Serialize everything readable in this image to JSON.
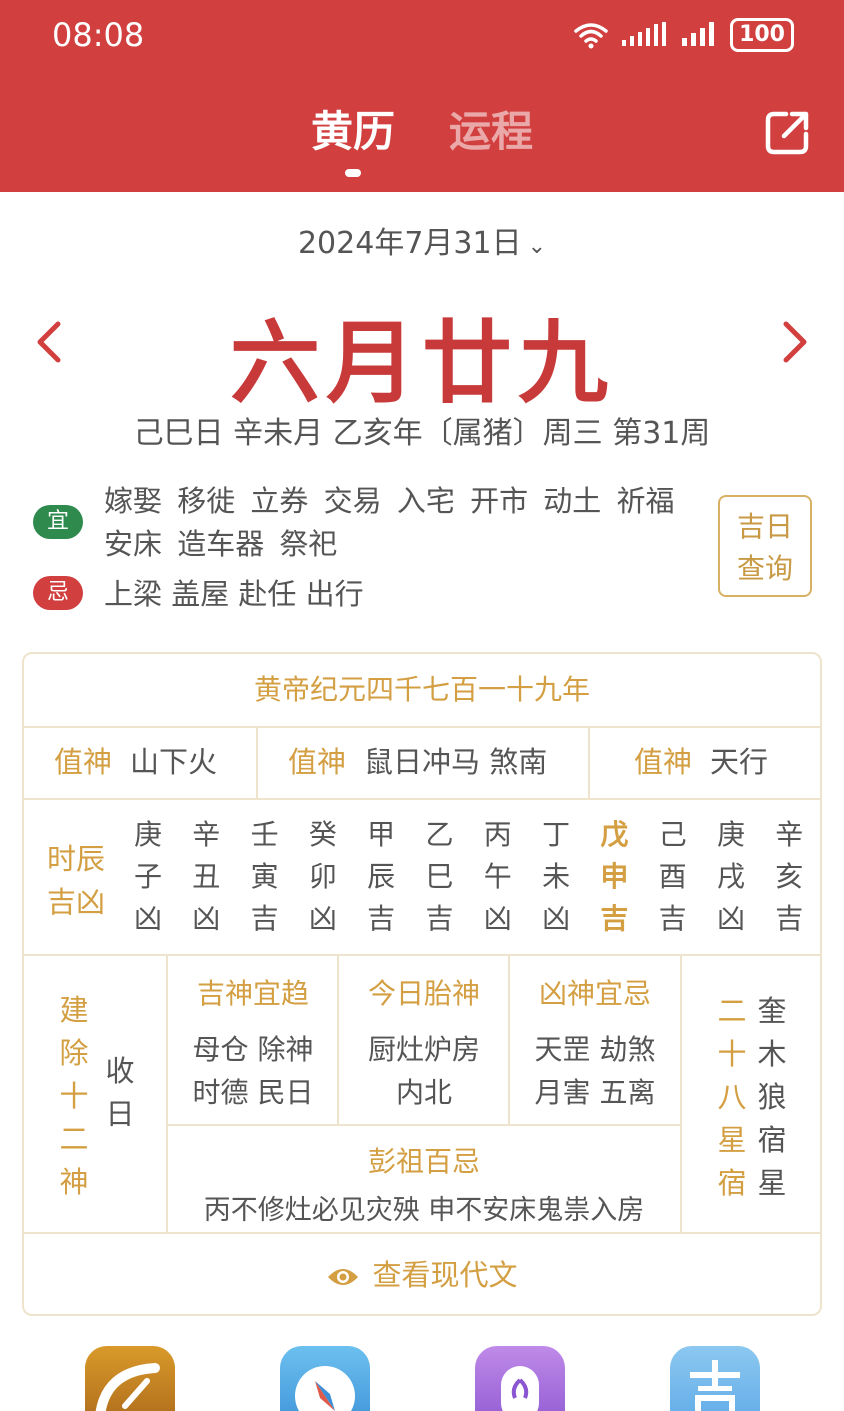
{
  "status": {
    "time": "08:08",
    "battery": "100"
  },
  "tabs": [
    {
      "label": "黄历",
      "active": true
    },
    {
      "label": "运程",
      "active": false
    }
  ],
  "date": {
    "solar": "2024年7月31日",
    "lunar": "六月廿九",
    "ganzhi": "己巳日 辛未月 乙亥年〔属猪〕周三 第31周"
  },
  "yi": {
    "badge": "宜",
    "text": "嫁娶 移徙 立券 交易 入宅 开市 动土 祈福 安床 造车器 祭祀"
  },
  "ji": {
    "badge": "忌",
    "text": "上梁 盖屋 赴任 出行"
  },
  "jiri_button": {
    "line1": "吉日",
    "line2": "查询"
  },
  "almanac": {
    "era": "黄帝纪元四千七百一十九年",
    "zhishen": [
      {
        "key": "值神",
        "value": "山下火"
      },
      {
        "key": "值神",
        "value": "鼠日冲马 煞南"
      },
      {
        "key": "值神",
        "value": "天行"
      }
    ],
    "hours_title": {
      "line1": "时辰",
      "line2": "吉凶"
    },
    "hours": [
      {
        "gan": "庚",
        "zhi": "子",
        "luck": "凶"
      },
      {
        "gan": "辛",
        "zhi": "丑",
        "luck": "凶"
      },
      {
        "gan": "壬",
        "zhi": "寅",
        "luck": "吉"
      },
      {
        "gan": "癸",
        "zhi": "卯",
        "luck": "凶"
      },
      {
        "gan": "甲",
        "zhi": "辰",
        "luck": "吉"
      },
      {
        "gan": "乙",
        "zhi": "巳",
        "luck": "吉"
      },
      {
        "gan": "丙",
        "zhi": "午",
        "luck": "凶"
      },
      {
        "gan": "丁",
        "zhi": "未",
        "luck": "凶"
      },
      {
        "gan": "戊",
        "zhi": "申",
        "luck": "吉"
      },
      {
        "gan": "己",
        "zhi": "酉",
        "luck": "吉"
      },
      {
        "gan": "庚",
        "zhi": "戌",
        "luck": "凶"
      },
      {
        "gan": "辛",
        "zhi": "亥",
        "luck": "吉"
      }
    ],
    "current_hour_index": 8,
    "jianchu": {
      "t1": "建",
      "t2": "除",
      "t3": "十",
      "t4": "二",
      "t5": "神",
      "v1": "收",
      "v2": "日"
    },
    "jishen": {
      "title": "吉神宜趋",
      "line1": "母仓 除神",
      "line2": "时德 民日"
    },
    "taishen": {
      "title": "今日胎神",
      "line1": "厨灶炉房",
      "line2": "内北"
    },
    "xiongshen": {
      "title": "凶神宜忌",
      "line1": "天罡 劫煞",
      "line2": "月害 五离"
    },
    "pengzu": {
      "title": "彭祖百忌",
      "text": "丙不修灶必见灾殃 申不安床鬼祟入房"
    },
    "xiu": {
      "t1": "二",
      "t2": "十",
      "t3": "八",
      "t4": "星",
      "t5": "宿",
      "v1": "奎",
      "v2": "木",
      "v3": "狼",
      "v4": "宿",
      "v5": "星"
    },
    "modern_link": "查看现代文"
  },
  "colors": {
    "header": "#d13f3f",
    "gold": "#d39f42",
    "green": "#2e8a4d"
  }
}
